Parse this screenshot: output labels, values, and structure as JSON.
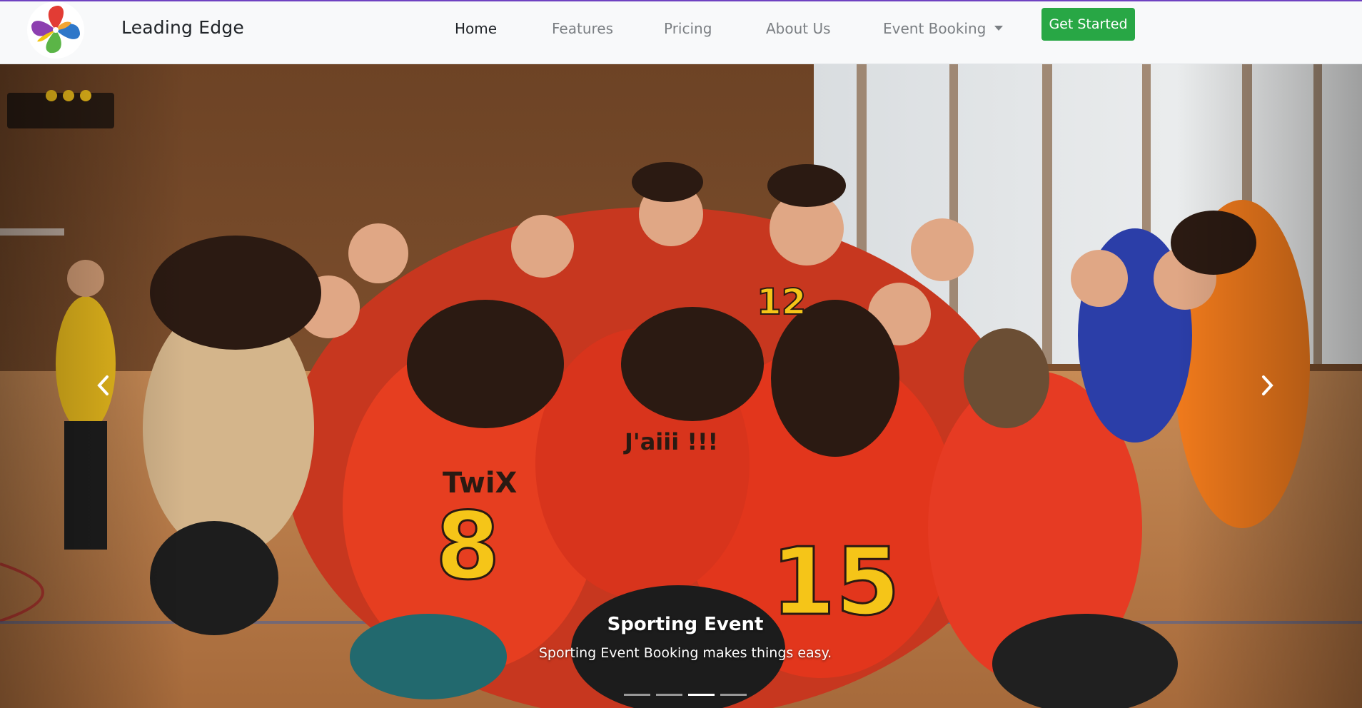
{
  "brand": {
    "name": "Leading Edge",
    "logo_icon": "pinwheel-logo-icon"
  },
  "nav": {
    "items": [
      {
        "label": "Home",
        "active": true
      },
      {
        "label": "Features",
        "active": false
      },
      {
        "label": "Pricing",
        "active": false
      },
      {
        "label": "About Us",
        "active": false
      },
      {
        "label": "Event Booking",
        "active": false,
        "dropdown": true
      }
    ],
    "cta_label": "Get Started"
  },
  "carousel": {
    "slide_title": "Sporting Event",
    "slide_text": "Sporting Event Booking makes things easy.",
    "indicator_count": 4,
    "active_indicator": 3,
    "prev_icon": "chevron-left-icon",
    "next_icon": "chevron-right-icon"
  },
  "colors": {
    "accent_top_border": "#6f42c1",
    "cta_green": "#28a745",
    "navbar_bg": "#f8f9fa"
  }
}
